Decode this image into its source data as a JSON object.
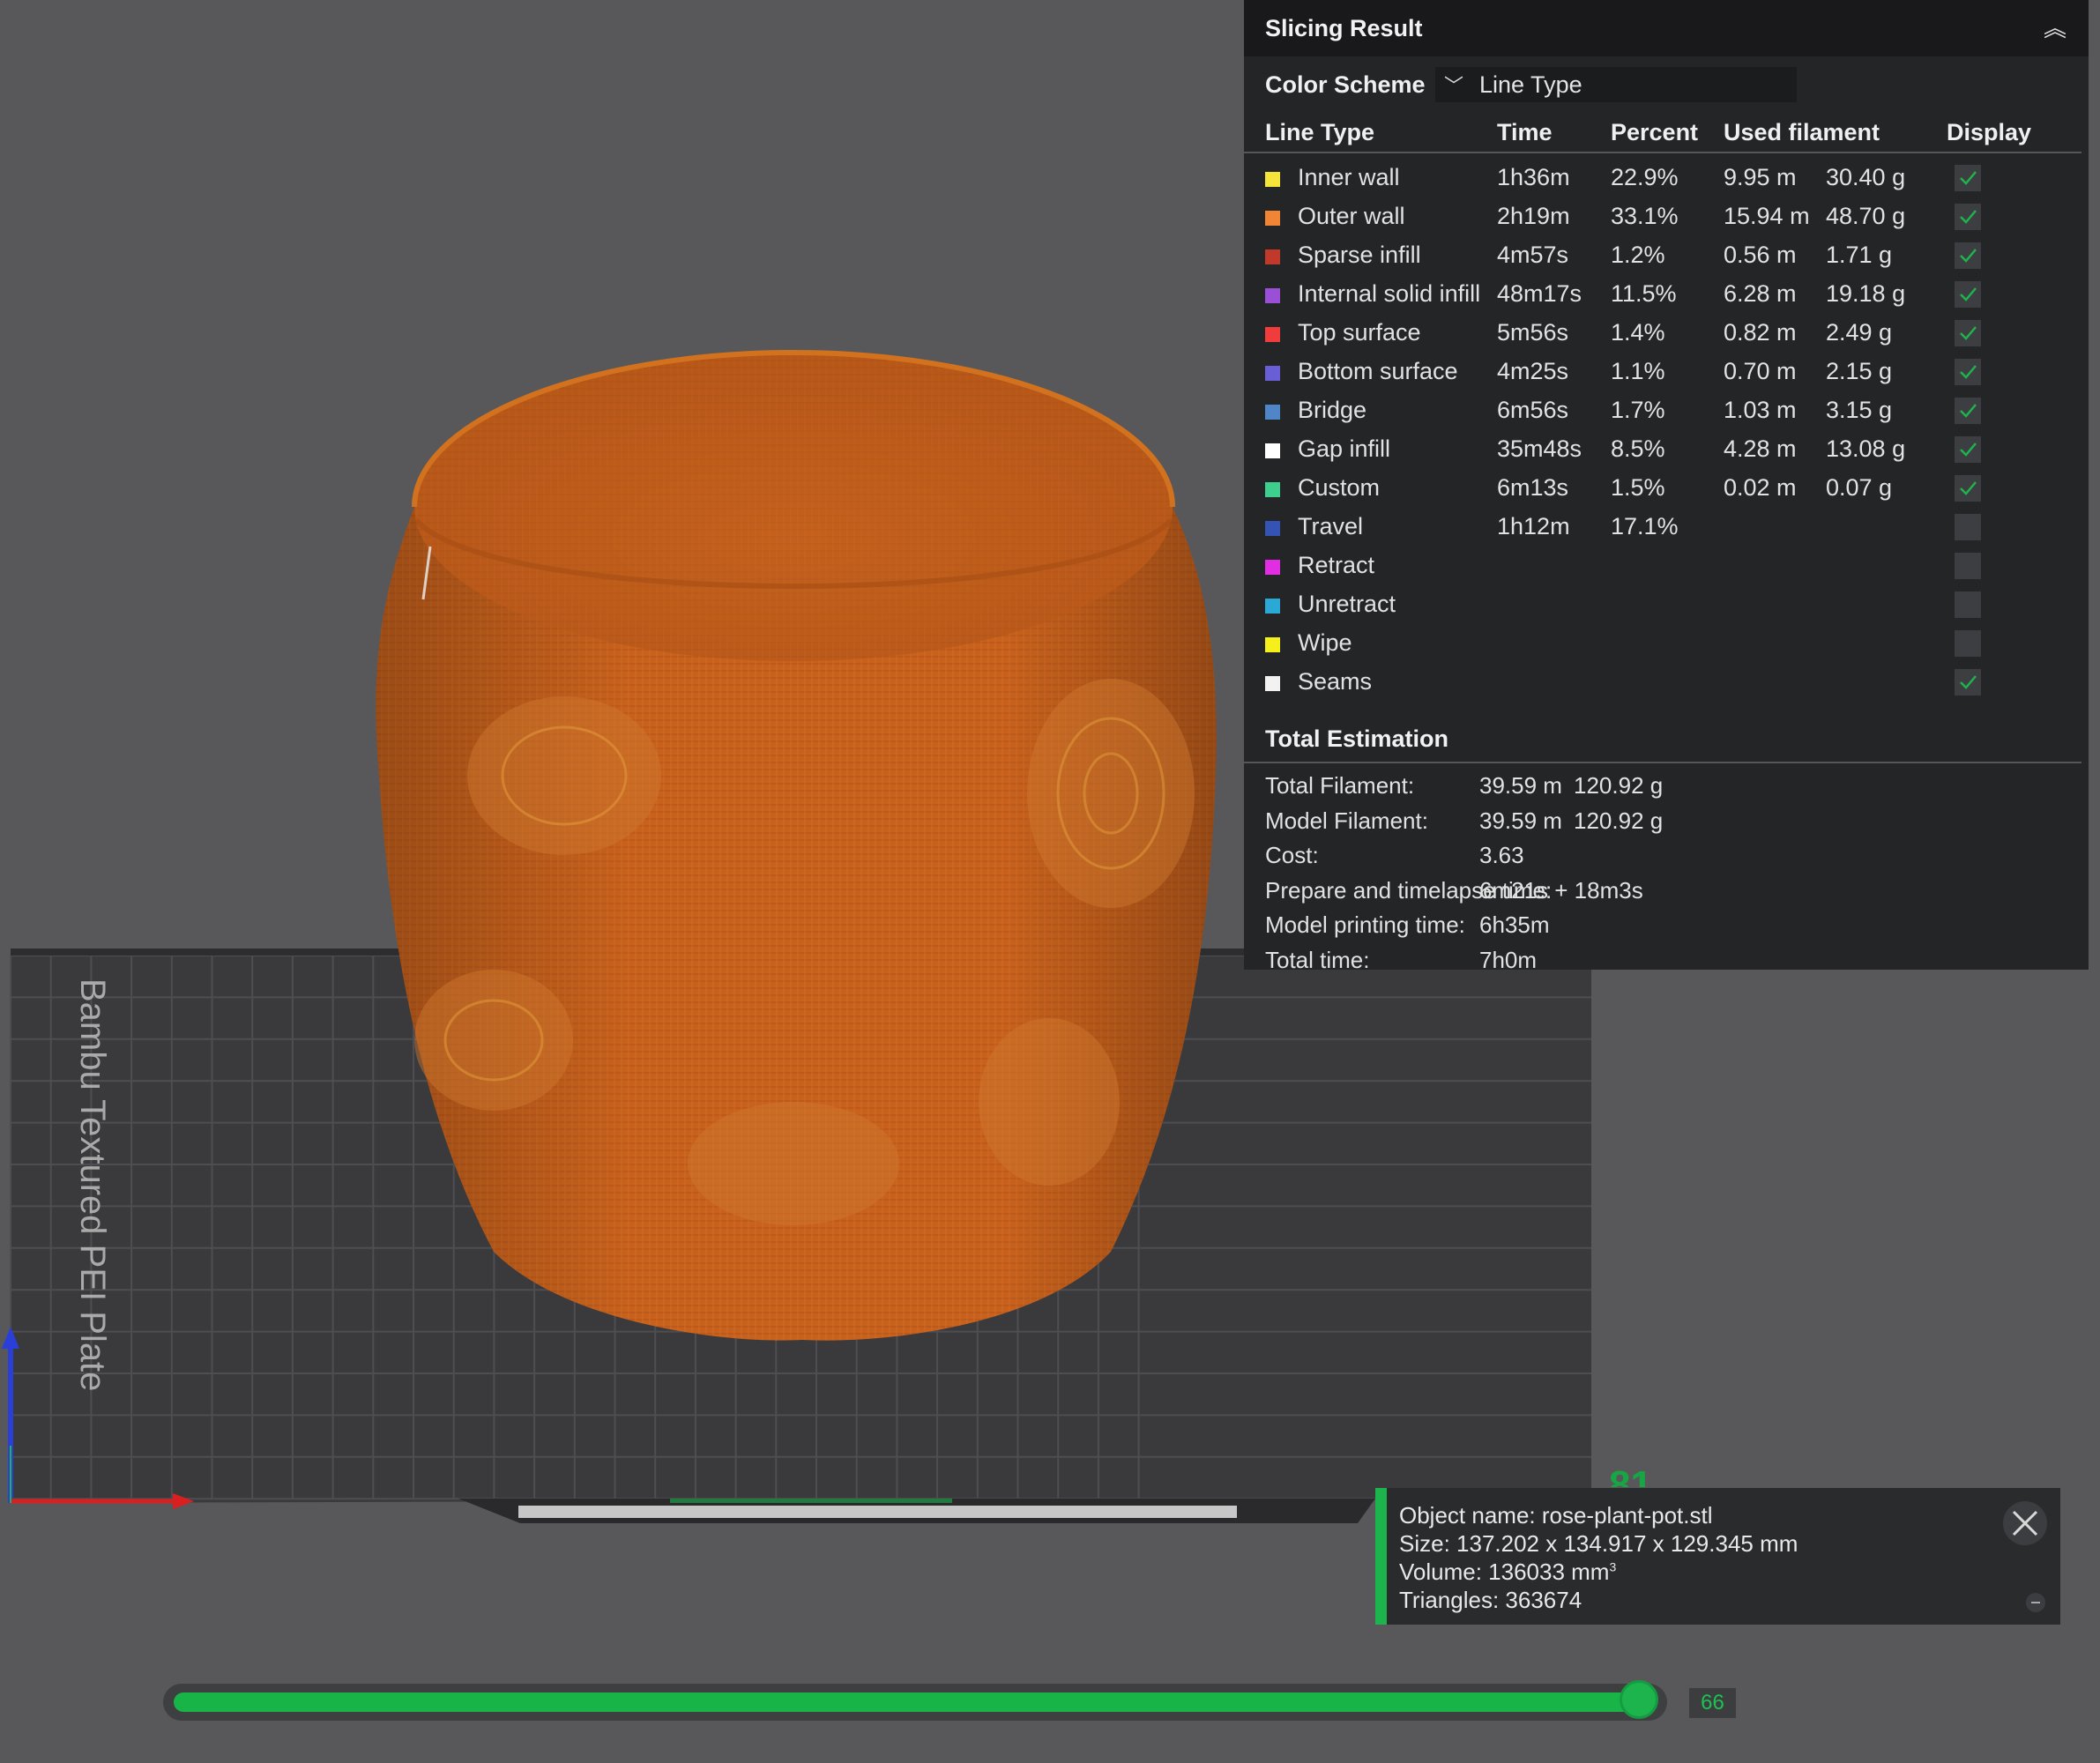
{
  "viewport": {
    "plate_label": "Bambu Textured PEI Plate",
    "model_color": "#c7611c",
    "top_layer_number": "81"
  },
  "slicing_result": {
    "title": "Slicing Result",
    "color_scheme_label": "Color Scheme",
    "color_scheme_value": "Line Type",
    "columns": [
      "Line Type",
      "Time",
      "Percent",
      "Used filament",
      "Display"
    ],
    "rows": [
      {
        "name": "Inner wall",
        "color": "#f5e53a",
        "time": "1h36m",
        "percent": "22.9%",
        "length": "9.95 m",
        "weight": "30.40 g",
        "display": true
      },
      {
        "name": "Outer wall",
        "color": "#f08535",
        "time": "2h19m",
        "percent": "33.1%",
        "length": "15.94 m",
        "weight": "48.70 g",
        "display": true
      },
      {
        "name": "Sparse infill",
        "color": "#c0392b",
        "time": "4m57s",
        "percent": "1.2%",
        "length": "0.56 m",
        "weight": "1.71 g",
        "display": true
      },
      {
        "name": "Internal solid infill",
        "color": "#9b4fd6",
        "time": "48m17s",
        "percent": "11.5%",
        "length": "6.28 m",
        "weight": "19.18 g",
        "display": true
      },
      {
        "name": "Top surface",
        "color": "#f03c3c",
        "time": "5m56s",
        "percent": "1.4%",
        "length": "0.82 m",
        "weight": "2.49 g",
        "display": true
      },
      {
        "name": "Bottom surface",
        "color": "#6a5ed6",
        "time": "4m25s",
        "percent": "1.1%",
        "length": "0.70 m",
        "weight": "2.15 g",
        "display": true
      },
      {
        "name": "Bridge",
        "color": "#4f86c8",
        "time": "6m56s",
        "percent": "1.7%",
        "length": "1.03 m",
        "weight": "3.15 g",
        "display": true
      },
      {
        "name": "Gap infill",
        "color": "#ffffff",
        "time": "35m48s",
        "percent": "8.5%",
        "length": "4.28 m",
        "weight": "13.08 g",
        "display": true
      },
      {
        "name": "Custom",
        "color": "#3ecf8e",
        "time": "6m13s",
        "percent": "1.5%",
        "length": "0.02 m",
        "weight": "0.07 g",
        "display": true
      },
      {
        "name": "Travel",
        "color": "#3553b5",
        "time": "1h12m",
        "percent": "17.1%",
        "length": "",
        "weight": "",
        "display": false
      },
      {
        "name": "Retract",
        "color": "#e22ee2",
        "time": "",
        "percent": "",
        "length": "",
        "weight": "",
        "display": false
      },
      {
        "name": "Unretract",
        "color": "#2aa8d6",
        "time": "",
        "percent": "",
        "length": "",
        "weight": "",
        "display": false
      },
      {
        "name": "Wipe",
        "color": "#f5ef1c",
        "time": "",
        "percent": "",
        "length": "",
        "weight": "",
        "display": false
      },
      {
        "name": "Seams",
        "color": "#f2f2f2",
        "time": "",
        "percent": "",
        "length": "",
        "weight": "",
        "display": true
      }
    ],
    "total_title": "Total Estimation",
    "totals": [
      {
        "label": "Total Filament:",
        "v1": "39.59 m",
        "v2": "120.92 g"
      },
      {
        "label": "Model Filament:",
        "v1": "39.59 m",
        "v2": "120.92 g"
      },
      {
        "label": "Cost:",
        "v1": "3.63",
        "v2": ""
      },
      {
        "label": "Prepare and timelapse time:",
        "v1": "6m21s + 18m3s",
        "v2": ""
      },
      {
        "label": "Model printing time:",
        "v1": "6h35m",
        "v2": ""
      },
      {
        "label": "Total time:",
        "v1": "7h0m",
        "v2": ""
      }
    ]
  },
  "object_info": {
    "name": "Object name: rose-plant-pot.stl",
    "size": "Size: 137.202 x 134.917 x 129.345 mm",
    "volume": "Volume: 136033 mm",
    "volume_unit_sup": "3",
    "triangles": "Triangles: 363674"
  },
  "layer_slider": {
    "value": "66",
    "fill_fraction": 1.0
  },
  "colors": {
    "accent": "#1db34d",
    "panel_bg": "#242527",
    "background": "#58585a"
  }
}
